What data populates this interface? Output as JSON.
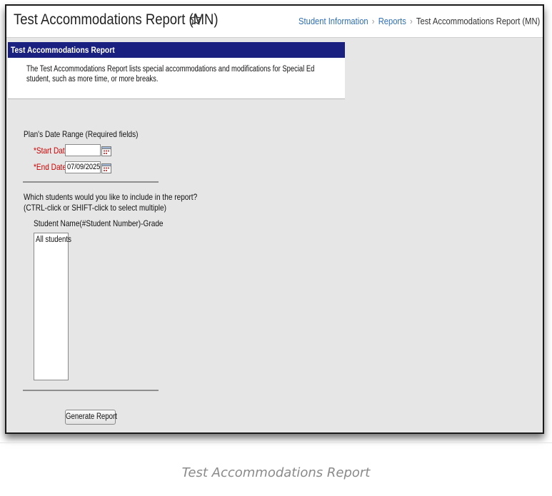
{
  "page": {
    "title": "Test Accommodations Report (MN)",
    "breadcrumb": [
      {
        "label": "Student Information",
        "link": true
      },
      {
        "label": "Reports",
        "link": true
      },
      {
        "label": "Test Accommodations Report (MN)",
        "link": false
      }
    ]
  },
  "report": {
    "header": "Test Accommodations Report",
    "description": "The Test Accommodations Report lists special accommodations and modifications for Special Ed student, such as more time, or more breaks."
  },
  "form": {
    "date_range_label": "Plan's Date Range (Required fields)",
    "start_date_label": "*Start Date:",
    "start_date_value": "",
    "end_date_label": "*End Date:",
    "end_date_value": "07/09/2025",
    "students_question": "Which students would you like to include in the report?",
    "students_hint": "(CTRL-click or SHIFT-click to select multiple)",
    "student_column_label": "Student Name(#Student Number)-Grade",
    "student_options": [
      "All students"
    ],
    "generate_button": "Generate Report"
  },
  "caption": "Test Accommodations Report",
  "colors": {
    "header_bg": "#1a2080",
    "required_label": "#cc0000",
    "link": "#2f6fb5",
    "page_bg": "#e6e6e6"
  },
  "icons": [
    "star-icon",
    "calendar-icon"
  ]
}
